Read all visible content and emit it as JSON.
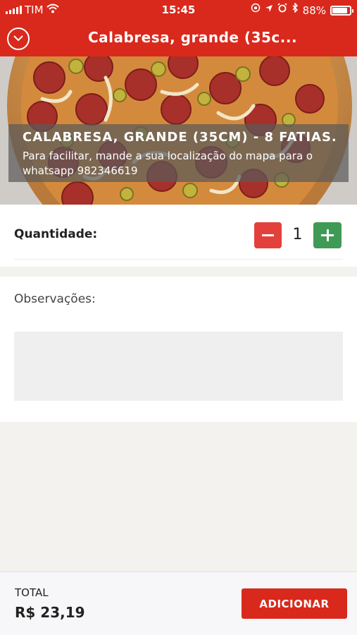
{
  "status_bar": {
    "carrier": "TIM",
    "time": "15:45",
    "battery": "88%",
    "battery_level": 0.88,
    "icons": [
      "signal-icon",
      "wifi-icon",
      "screen-rotation-lock-icon",
      "location-icon",
      "alarm-icon",
      "bluetooth-icon",
      "battery-icon"
    ]
  },
  "nav": {
    "title": "Calabresa, grande (35c...",
    "back_icon": "chevron-down-circle-icon"
  },
  "product": {
    "name": "CALABRESA, GRANDE (35CM) - 8 FATIAS.",
    "description": "Para facilitar, mande a sua localização do mapa para o whatsapp 982346619"
  },
  "quantity": {
    "label": "Quantidade:",
    "value": "1",
    "minus_icon": "minus-icon",
    "plus_icon": "plus-icon"
  },
  "observations": {
    "label": "Observações:",
    "value": "",
    "placeholder": ""
  },
  "footer": {
    "total_label": "TOTAL",
    "total_value": "R$ 23,19",
    "add_label": "ADICIONAR"
  },
  "colors": {
    "brand_red": "#d9291c",
    "minus_red": "#e3403b",
    "plus_green": "#3f9a55"
  }
}
